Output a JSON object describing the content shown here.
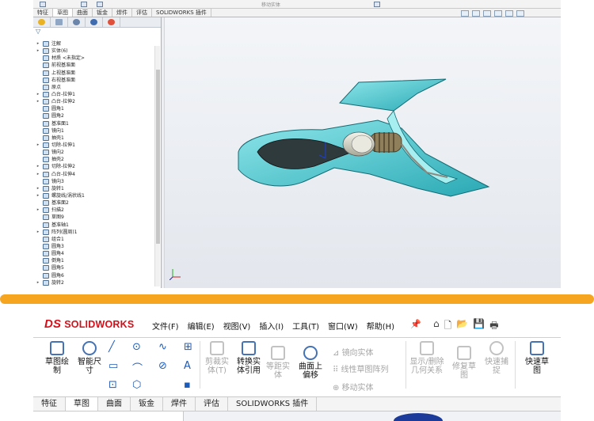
{
  "top_window": {
    "toolbar": {
      "move_entity": "移动实体"
    },
    "tabs": [
      {
        "label": "特征",
        "active": false
      },
      {
        "label": "草图",
        "active": true
      },
      {
        "label": "曲面",
        "active": false
      },
      {
        "label": "钣金",
        "active": false
      },
      {
        "label": "焊件",
        "active": false
      },
      {
        "label": "评估",
        "active": false
      },
      {
        "label": "SOLIDWORKS 插件",
        "active": false
      }
    ],
    "feature_tree": [
      {
        "label": "注解",
        "expand": "▸"
      },
      {
        "label": "实体(6)",
        "expand": "▸"
      },
      {
        "label": "材质 <未指定>",
        "expand": ""
      },
      {
        "label": "前视基准面",
        "expand": ""
      },
      {
        "label": "上视基准面",
        "expand": ""
      },
      {
        "label": "右视基准面",
        "expand": ""
      },
      {
        "label": "原点",
        "expand": ""
      },
      {
        "label": "凸台-拉伸1",
        "expand": "▸"
      },
      {
        "label": "凸台-拉伸2",
        "expand": "▸"
      },
      {
        "label": "圆角1",
        "expand": ""
      },
      {
        "label": "圆角2",
        "expand": ""
      },
      {
        "label": "基准面1",
        "expand": ""
      },
      {
        "label": "镜向1",
        "expand": ""
      },
      {
        "label": "抽壳1",
        "expand": ""
      },
      {
        "label": "切除-拉伸1",
        "expand": "▸"
      },
      {
        "label": "镜向2",
        "expand": ""
      },
      {
        "label": "抽壳2",
        "expand": ""
      },
      {
        "label": "切除-拉伸2",
        "expand": "▸"
      },
      {
        "label": "凸台-拉伸4",
        "expand": "▸"
      },
      {
        "label": "镜向3",
        "expand": ""
      },
      {
        "label": "旋转1",
        "expand": "▸"
      },
      {
        "label": "螺旋线/涡状线1",
        "expand": "▸"
      },
      {
        "label": "基准面2",
        "expand": ""
      },
      {
        "label": "扫描2",
        "expand": "▸"
      },
      {
        "label": "草图9",
        "expand": ""
      },
      {
        "label": "基准轴1",
        "expand": ""
      },
      {
        "label": "阵列(圆周)1",
        "expand": "▸"
      },
      {
        "label": "组合1",
        "expand": ""
      },
      {
        "label": "圆角3",
        "expand": ""
      },
      {
        "label": "圆角4",
        "expand": ""
      },
      {
        "label": "倒角1",
        "expand": ""
      },
      {
        "label": "圆角5",
        "expand": ""
      },
      {
        "label": "圆角6",
        "expand": ""
      },
      {
        "label": "旋转2",
        "expand": "▸"
      }
    ]
  },
  "bottom_window": {
    "logo": {
      "mark": "DS",
      "text": "SOLIDWORKS"
    },
    "menus": [
      "文件(F)",
      "编辑(E)",
      "视图(V)",
      "插入(I)",
      "工具(T)",
      "窗口(W)",
      "帮助(H)"
    ],
    "pin": "📌",
    "qat": [
      "⌂",
      "🗋",
      "📂",
      "💾",
      "🖶"
    ],
    "ribbon": {
      "sketch": "草图绘\n制",
      "smart_dim": "智能尺\n寸",
      "trim": "剪裁实\n体(T)",
      "convert": "转换实\n体引用",
      "offset": "等距实\n体",
      "surface_offset": "曲面上\n偏移",
      "mirror": "镜向实体",
      "linear": "线性草图阵列",
      "move": "移动实体",
      "show_delete": "显示/删除\n几何关系",
      "repair": "修复草\n图",
      "quick_snap": "快速捕\n捉",
      "quick_sketch": "快速草\n图"
    },
    "tabs": [
      {
        "label": "特征",
        "active": false
      },
      {
        "label": "草图",
        "active": true
      },
      {
        "label": "曲面",
        "active": false
      },
      {
        "label": "钣金",
        "active": false
      },
      {
        "label": "焊件",
        "active": false
      },
      {
        "label": "评估",
        "active": false
      },
      {
        "label": "SOLIDWORKS 插件",
        "active": false
      }
    ]
  },
  "colors": {
    "divider": "#f6a520",
    "brand": "#d4101a",
    "model": "#5bcfd6",
    "model_dark": "#1c8a95"
  }
}
